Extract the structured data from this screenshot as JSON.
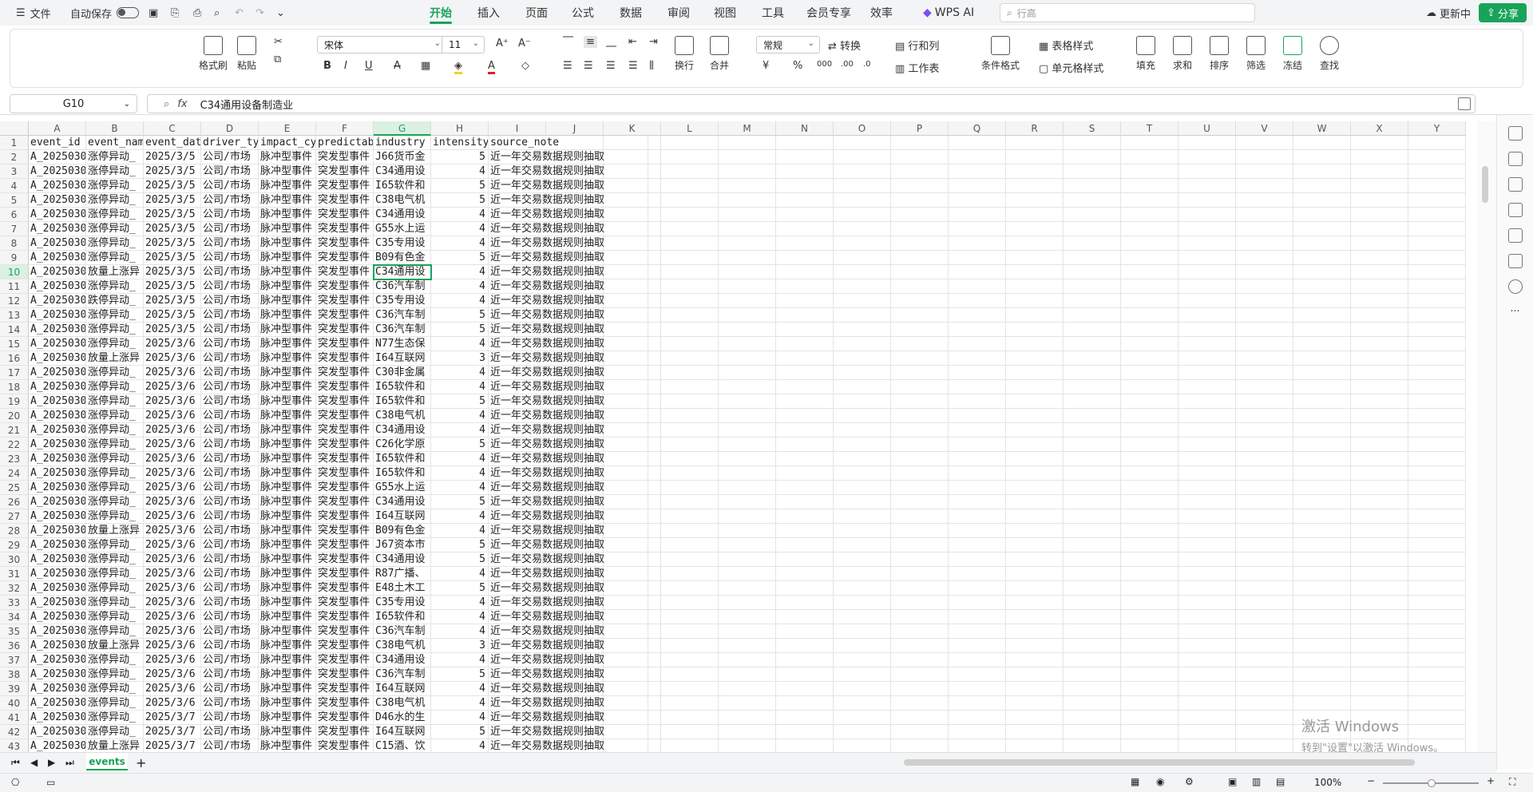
{
  "menubar": {
    "file": "文件",
    "autosave": "自动保存",
    "tabs": [
      "开始",
      "插入",
      "页面",
      "公式",
      "数据",
      "审阅",
      "视图",
      "工具",
      "会员专享",
      "效率",
      "WPS AI"
    ],
    "search_placeholder": "行高",
    "update": "更新中",
    "share": "分享"
  },
  "ribbon": {
    "format_painter": "格式刷",
    "paste": "粘贴",
    "font": "宋体",
    "font_size": "11",
    "number_format": "常规",
    "convert": "转换",
    "row_col": "行和列",
    "worksheet": "工作表",
    "cond_format": "条件格式",
    "table_style": "表格样式",
    "cell_style": "单元格样式",
    "wrap": "换行",
    "merge": "合并",
    "fill": "填充",
    "sum": "求和",
    "sort": "排序",
    "filter": "筛选",
    "freeze": "冻结",
    "find": "查找"
  },
  "formula_bar": {
    "name_box": "G10",
    "fx": "fx",
    "content": "C34通用设备制造业"
  },
  "columns": [
    "A",
    "B",
    "C",
    "D",
    "E",
    "F",
    "G",
    "H",
    "I",
    "J",
    "K",
    "L",
    "M",
    "N",
    "O",
    "P",
    "Q",
    "R",
    "S",
    "T",
    "U",
    "V",
    "W",
    "X",
    "Y"
  ],
  "headers": [
    "event_id",
    "event_name",
    "event_date",
    "driver_type",
    "impact_cycle",
    "predictability",
    "industry",
    "intensity",
    "source_note"
  ],
  "rows": [
    [
      "A_2025030",
      "涨停异动_",
      "2025/3/5",
      "公司/市场",
      "脉冲型事件",
      "突发型事件",
      "J66货币金",
      "5",
      "近一年交易数据规则抽取"
    ],
    [
      "A_2025030",
      "涨停异动_",
      "2025/3/5",
      "公司/市场",
      "脉冲型事件",
      "突发型事件",
      "C34通用设",
      "4",
      "近一年交易数据规则抽取"
    ],
    [
      "A_2025030",
      "涨停异动_",
      "2025/3/5",
      "公司/市场",
      "脉冲型事件",
      "突发型事件",
      "I65软件和",
      "5",
      "近一年交易数据规则抽取"
    ],
    [
      "A_2025030",
      "涨停异动_",
      "2025/3/5",
      "公司/市场",
      "脉冲型事件",
      "突发型事件",
      "C38电气机",
      "5",
      "近一年交易数据规则抽取"
    ],
    [
      "A_2025030",
      "涨停异动_",
      "2025/3/5",
      "公司/市场",
      "脉冲型事件",
      "突发型事件",
      "C34通用设",
      "4",
      "近一年交易数据规则抽取"
    ],
    [
      "A_2025030",
      "涨停异动_",
      "2025/3/5",
      "公司/市场",
      "脉冲型事件",
      "突发型事件",
      "G55水上运",
      "4",
      "近一年交易数据规则抽取"
    ],
    [
      "A_2025030",
      "涨停异动_",
      "2025/3/5",
      "公司/市场",
      "脉冲型事件",
      "突发型事件",
      "C35专用设",
      "4",
      "近一年交易数据规则抽取"
    ],
    [
      "A_2025030",
      "涨停异动_",
      "2025/3/5",
      "公司/市场",
      "脉冲型事件",
      "突发型事件",
      "B09有色金",
      "5",
      "近一年交易数据规则抽取"
    ],
    [
      "A_2025030",
      "放量上涨异",
      "2025/3/5",
      "公司/市场",
      "脉冲型事件",
      "突发型事件",
      "C34通用设",
      "4",
      "近一年交易数据规则抽取"
    ],
    [
      "A_2025030",
      "涨停异动_",
      "2025/3/5",
      "公司/市场",
      "脉冲型事件",
      "突发型事件",
      "C36汽车制",
      "4",
      "近一年交易数据规则抽取"
    ],
    [
      "A_2025030",
      "跌停异动_",
      "2025/3/5",
      "公司/市场",
      "脉冲型事件",
      "突发型事件",
      "C35专用设",
      "4",
      "近一年交易数据规则抽取"
    ],
    [
      "A_2025030",
      "涨停异动_",
      "2025/3/5",
      "公司/市场",
      "脉冲型事件",
      "突发型事件",
      "C36汽车制",
      "5",
      "近一年交易数据规则抽取"
    ],
    [
      "A_2025030",
      "涨停异动_",
      "2025/3/5",
      "公司/市场",
      "脉冲型事件",
      "突发型事件",
      "C36汽车制",
      "5",
      "近一年交易数据规则抽取"
    ],
    [
      "A_2025030",
      "涨停异动_",
      "2025/3/6",
      "公司/市场",
      "脉冲型事件",
      "突发型事件",
      "N77生态保",
      "4",
      "近一年交易数据规则抽取"
    ],
    [
      "A_2025030",
      "放量上涨异",
      "2025/3/6",
      "公司/市场",
      "脉冲型事件",
      "突发型事件",
      "I64互联网",
      "3",
      "近一年交易数据规则抽取"
    ],
    [
      "A_2025030",
      "涨停异动_",
      "2025/3/6",
      "公司/市场",
      "脉冲型事件",
      "突发型事件",
      "C30非金属",
      "4",
      "近一年交易数据规则抽取"
    ],
    [
      "A_2025030",
      "涨停异动_",
      "2025/3/6",
      "公司/市场",
      "脉冲型事件",
      "突发型事件",
      "I65软件和",
      "4",
      "近一年交易数据规则抽取"
    ],
    [
      "A_2025030",
      "涨停异动_",
      "2025/3/6",
      "公司/市场",
      "脉冲型事件",
      "突发型事件",
      "I65软件和",
      "5",
      "近一年交易数据规则抽取"
    ],
    [
      "A_2025030",
      "涨停异动_",
      "2025/3/6",
      "公司/市场",
      "脉冲型事件",
      "突发型事件",
      "C38电气机",
      "4",
      "近一年交易数据规则抽取"
    ],
    [
      "A_2025030",
      "涨停异动_",
      "2025/3/6",
      "公司/市场",
      "脉冲型事件",
      "突发型事件",
      "C34通用设",
      "4",
      "近一年交易数据规则抽取"
    ],
    [
      "A_2025030",
      "涨停异动_",
      "2025/3/6",
      "公司/市场",
      "脉冲型事件",
      "突发型事件",
      "C26化学原",
      "5",
      "近一年交易数据规则抽取"
    ],
    [
      "A_2025030",
      "涨停异动_",
      "2025/3/6",
      "公司/市场",
      "脉冲型事件",
      "突发型事件",
      "I65软件和",
      "4",
      "近一年交易数据规则抽取"
    ],
    [
      "A_2025030",
      "涨停异动_",
      "2025/3/6",
      "公司/市场",
      "脉冲型事件",
      "突发型事件",
      "I65软件和",
      "4",
      "近一年交易数据规则抽取"
    ],
    [
      "A_2025030",
      "涨停异动_",
      "2025/3/6",
      "公司/市场",
      "脉冲型事件",
      "突发型事件",
      "G55水上运",
      "4",
      "近一年交易数据规则抽取"
    ],
    [
      "A_2025030",
      "涨停异动_",
      "2025/3/6",
      "公司/市场",
      "脉冲型事件",
      "突发型事件",
      "C34通用设",
      "5",
      "近一年交易数据规则抽取"
    ],
    [
      "A_2025030",
      "涨停异动_",
      "2025/3/6",
      "公司/市场",
      "脉冲型事件",
      "突发型事件",
      "I64互联网",
      "4",
      "近一年交易数据规则抽取"
    ],
    [
      "A_2025030",
      "放量上涨异",
      "2025/3/6",
      "公司/市场",
      "脉冲型事件",
      "突发型事件",
      "B09有色金",
      "4",
      "近一年交易数据规则抽取"
    ],
    [
      "A_2025030",
      "涨停异动_",
      "2025/3/6",
      "公司/市场",
      "脉冲型事件",
      "突发型事件",
      "J67资本市",
      "5",
      "近一年交易数据规则抽取"
    ],
    [
      "A_2025030",
      "涨停异动_",
      "2025/3/6",
      "公司/市场",
      "脉冲型事件",
      "突发型事件",
      "C34通用设",
      "5",
      "近一年交易数据规则抽取"
    ],
    [
      "A_2025030",
      "涨停异动_",
      "2025/3/6",
      "公司/市场",
      "脉冲型事件",
      "突发型事件",
      "R87广播、",
      "4",
      "近一年交易数据规则抽取"
    ],
    [
      "A_2025030",
      "涨停异动_",
      "2025/3/6",
      "公司/市场",
      "脉冲型事件",
      "突发型事件",
      "E48土木工",
      "5",
      "近一年交易数据规则抽取"
    ],
    [
      "A_2025030",
      "涨停异动_",
      "2025/3/6",
      "公司/市场",
      "脉冲型事件",
      "突发型事件",
      "C35专用设",
      "4",
      "近一年交易数据规则抽取"
    ],
    [
      "A_2025030",
      "涨停异动_",
      "2025/3/6",
      "公司/市场",
      "脉冲型事件",
      "突发型事件",
      "I65软件和",
      "4",
      "近一年交易数据规则抽取"
    ],
    [
      "A_2025030",
      "涨停异动_",
      "2025/3/6",
      "公司/市场",
      "脉冲型事件",
      "突发型事件",
      "C36汽车制",
      "4",
      "近一年交易数据规则抽取"
    ],
    [
      "A_2025030",
      "放量上涨异",
      "2025/3/6",
      "公司/市场",
      "脉冲型事件",
      "突发型事件",
      "C38电气机",
      "3",
      "近一年交易数据规则抽取"
    ],
    [
      "A_2025030",
      "涨停异动_",
      "2025/3/6",
      "公司/市场",
      "脉冲型事件",
      "突发型事件",
      "C34通用设",
      "4",
      "近一年交易数据规则抽取"
    ],
    [
      "A_2025030",
      "涨停异动_",
      "2025/3/6",
      "公司/市场",
      "脉冲型事件",
      "突发型事件",
      "C36汽车制",
      "5",
      "近一年交易数据规则抽取"
    ],
    [
      "A_2025030",
      "涨停异动_",
      "2025/3/6",
      "公司/市场",
      "脉冲型事件",
      "突发型事件",
      "I64互联网",
      "4",
      "近一年交易数据规则抽取"
    ],
    [
      "A_2025030",
      "涨停异动_",
      "2025/3/6",
      "公司/市场",
      "脉冲型事件",
      "突发型事件",
      "C38电气机",
      "4",
      "近一年交易数据规则抽取"
    ],
    [
      "A_2025030",
      "涨停异动_",
      "2025/3/7",
      "公司/市场",
      "脉冲型事件",
      "突发型事件",
      "D46水的生",
      "4",
      "近一年交易数据规则抽取"
    ],
    [
      "A_2025030",
      "涨停异动_",
      "2025/3/7",
      "公司/市场",
      "脉冲型事件",
      "突发型事件",
      "I64互联网",
      "5",
      "近一年交易数据规则抽取"
    ],
    [
      "A_2025030",
      "放量上涨异",
      "2025/3/7",
      "公司/市场",
      "脉冲型事件",
      "突发型事件",
      "C15酒、饮",
      "4",
      "近一年交易数据规则抽取"
    ]
  ],
  "sheet_tab": "events",
  "status": {
    "zoom": "100%"
  },
  "watermark": {
    "line1": "激活 Windows",
    "line2": "转到\"设置\"以激活 Windows。"
  }
}
